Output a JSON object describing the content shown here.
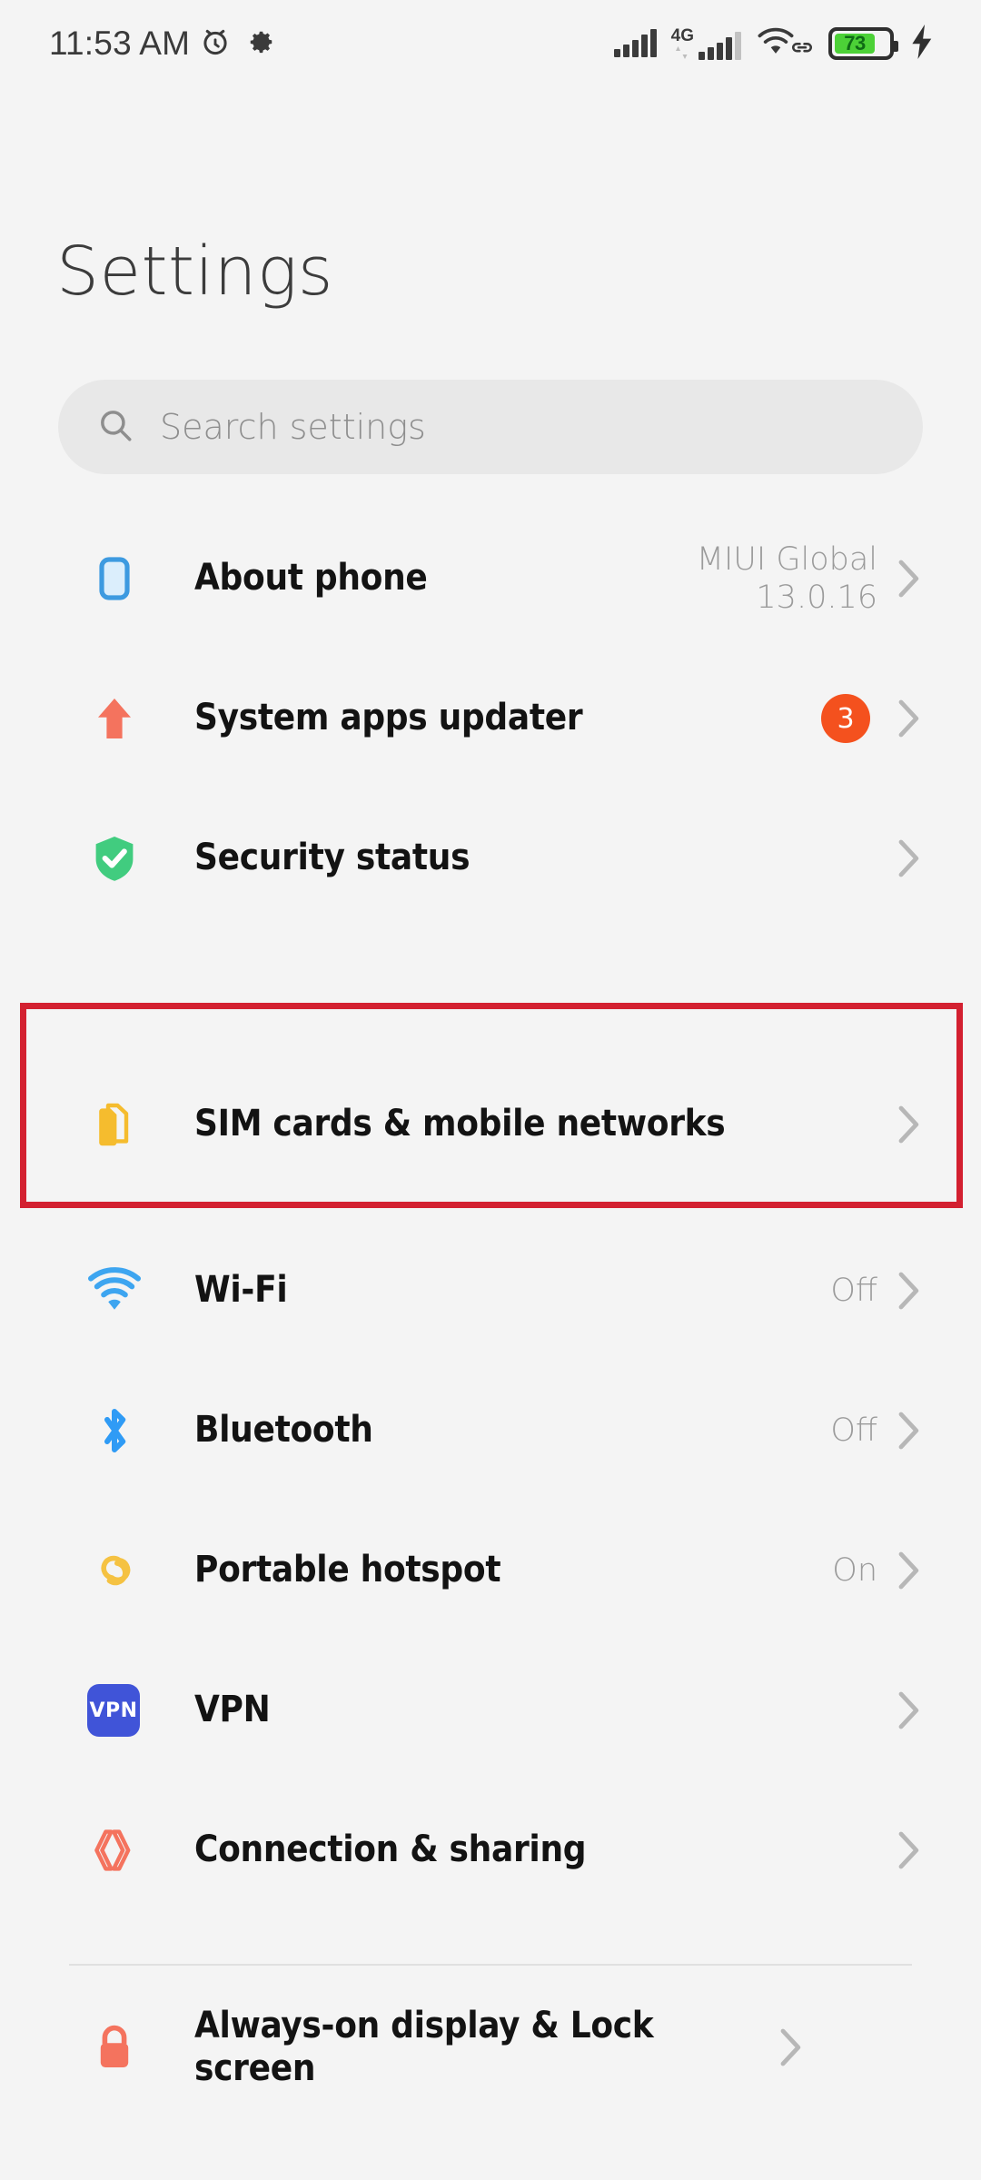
{
  "status_bar": {
    "time": "11:53 AM",
    "alarm_icon": "alarm-clock-icon",
    "settings_icon": "gear-icon",
    "signal_1_icon": "signal-bars-icon",
    "network_type": "4G",
    "signal_2_icon": "signal-bars-icon",
    "wifi_icon": "wifi-icon",
    "vpn_link_icon": "link-icon",
    "battery_level": "73",
    "charging_icon": "lightning-bolt-icon",
    "battery_fill_color": "#4cd137"
  },
  "header": {
    "title": "Settings"
  },
  "search": {
    "placeholder": "Search settings",
    "icon": "search-icon",
    "value": ""
  },
  "highlight": {
    "target": "SIM cards & mobile networks",
    "color": "#d32030"
  },
  "list": {
    "group_1": [
      {
        "label": "About phone",
        "value": "MIUI Global\n13.0.16",
        "icon": "phone-outline-icon",
        "icon_color": "#3d9ae0",
        "badge": "",
        "chevron": "›"
      },
      {
        "label": "System apps updater",
        "value": "",
        "icon": "up-arrow-icon",
        "icon_color": "#f4735e",
        "badge": "3",
        "chevron": "›"
      },
      {
        "label": "Security status",
        "value": "",
        "icon": "shield-check-icon",
        "icon_color": "#41cc7f",
        "badge": "",
        "chevron": "›"
      }
    ],
    "group_2": [
      {
        "label": "SIM cards & mobile networks",
        "value": "",
        "icon": "sim-card-icon",
        "icon_color": "#f5bc2e",
        "badge": "",
        "chevron": "›"
      },
      {
        "label": "Wi-Fi",
        "value": "Off",
        "icon": "wifi-icon",
        "icon_color": "#3da5f0",
        "badge": "",
        "chevron": "›"
      },
      {
        "label": "Bluetooth",
        "value": "Off",
        "icon": "bluetooth-icon",
        "icon_color": "#2f9bf5",
        "badge": "",
        "chevron": "›"
      },
      {
        "label": "Portable hotspot",
        "value": "On",
        "icon": "hotspot-icon",
        "icon_color": "#f5c242",
        "badge": "",
        "chevron": "›"
      },
      {
        "label": "VPN",
        "value": "",
        "icon": "vpn-icon",
        "icon_color": "#4054d8",
        "badge": "",
        "chevron": "›"
      },
      {
        "label": "Connection & sharing",
        "value": "",
        "icon": "connection-sharing-icon",
        "icon_color": "#f4735e",
        "badge": "",
        "chevron": "›"
      }
    ],
    "group_3": [
      {
        "label": "Always-on display & Lock screen",
        "value": "",
        "icon": "lock-icon",
        "icon_color": "#f4735e",
        "badge": "",
        "chevron": "›"
      }
    ]
  }
}
